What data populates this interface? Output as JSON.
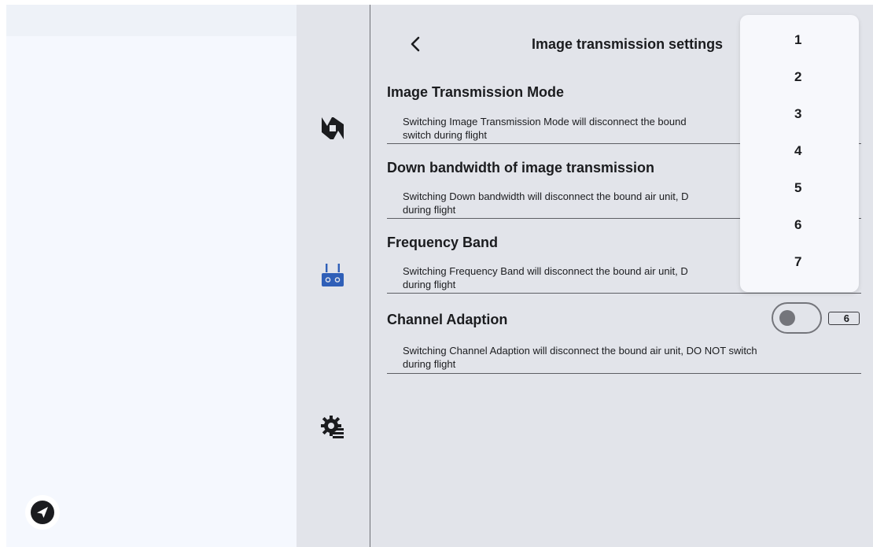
{
  "header": {
    "title": "Image transmission settings",
    "back_icon": "chevron-left-icon"
  },
  "sections": [
    {
      "title": "Image Transmission Mode",
      "description": "Switching Image Transmission Mode will disconnect the bound\nswitch during flight"
    },
    {
      "title": "Down bandwidth of image transmission",
      "description": "Switching Down bandwidth will disconnect the bound air unit, D\nduring flight"
    },
    {
      "title": "Frequency Band",
      "description": "Switching Frequency Band will disconnect the bound air unit, D\nduring flight"
    },
    {
      "title": "Channel Adaption",
      "description": "Switching Channel Adaption will disconnect the bound air unit, DO NOT switch\nduring flight"
    }
  ],
  "channel_adaption": {
    "toggle_state": "off",
    "channel_value": "6"
  },
  "dropdown": {
    "options": [
      "1",
      "2",
      "3",
      "4",
      "5",
      "6",
      "7"
    ]
  },
  "rail": {
    "icons": [
      "camera-aperture-icon",
      "remote-controller-icon",
      "gear-settings-icon"
    ]
  },
  "fab": {
    "icon": "send-icon"
  },
  "colors": {
    "background": "#e2e4ea",
    "left_pane": "#f5f8fe",
    "text": "#1b1c1f",
    "dropdown_bg": "#f7f8fc",
    "toggle_off": "#74757b"
  }
}
